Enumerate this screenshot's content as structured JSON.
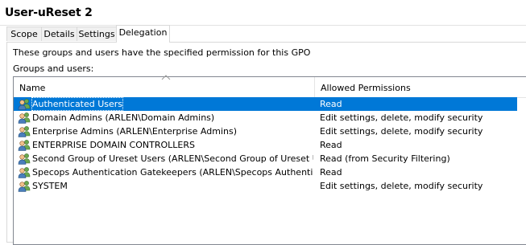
{
  "window": {
    "title": "User-uReset 2"
  },
  "tabs": [
    {
      "label": "Scope",
      "active": false
    },
    {
      "label": "Details",
      "active": false
    },
    {
      "label": "Settings",
      "active": false
    },
    {
      "label": "Delegation",
      "active": true
    }
  ],
  "delegation": {
    "description": "These groups and users have the specified permission for this GPO",
    "groups_label": "Groups and users:",
    "columns": {
      "name": "Name",
      "permissions": "Allowed Permissions"
    },
    "selection_color": "#0078d7",
    "rows": [
      {
        "icon": "users-group-icon",
        "name": "Authenticated Users",
        "permission": "Read",
        "selected": true
      },
      {
        "icon": "users-group-icon",
        "name": "Domain Admins (ARLEN\\Domain Admins)",
        "permission": "Edit settings, delete, modify security",
        "selected": false
      },
      {
        "icon": "users-group-icon",
        "name": "Enterprise Admins (ARLEN\\Enterprise Admins)",
        "permission": "Edit settings, delete, modify security",
        "selected": false
      },
      {
        "icon": "users-group-icon",
        "name": "ENTERPRISE DOMAIN CONTROLLERS",
        "permission": "Read",
        "selected": false
      },
      {
        "icon": "users-group-icon",
        "name": "Second Group of Ureset Users (ARLEN\\Second Group of Ureset Users)",
        "permission": "Read (from Security Filtering)",
        "selected": false
      },
      {
        "icon": "users-group-icon",
        "name": "Specops Authentication Gatekeepers (ARLEN\\Specops Authentication ...",
        "permission": "Read",
        "selected": false
      },
      {
        "icon": "users-group-icon",
        "name": "SYSTEM",
        "permission": "Edit settings, delete, modify security",
        "selected": false
      }
    ]
  }
}
